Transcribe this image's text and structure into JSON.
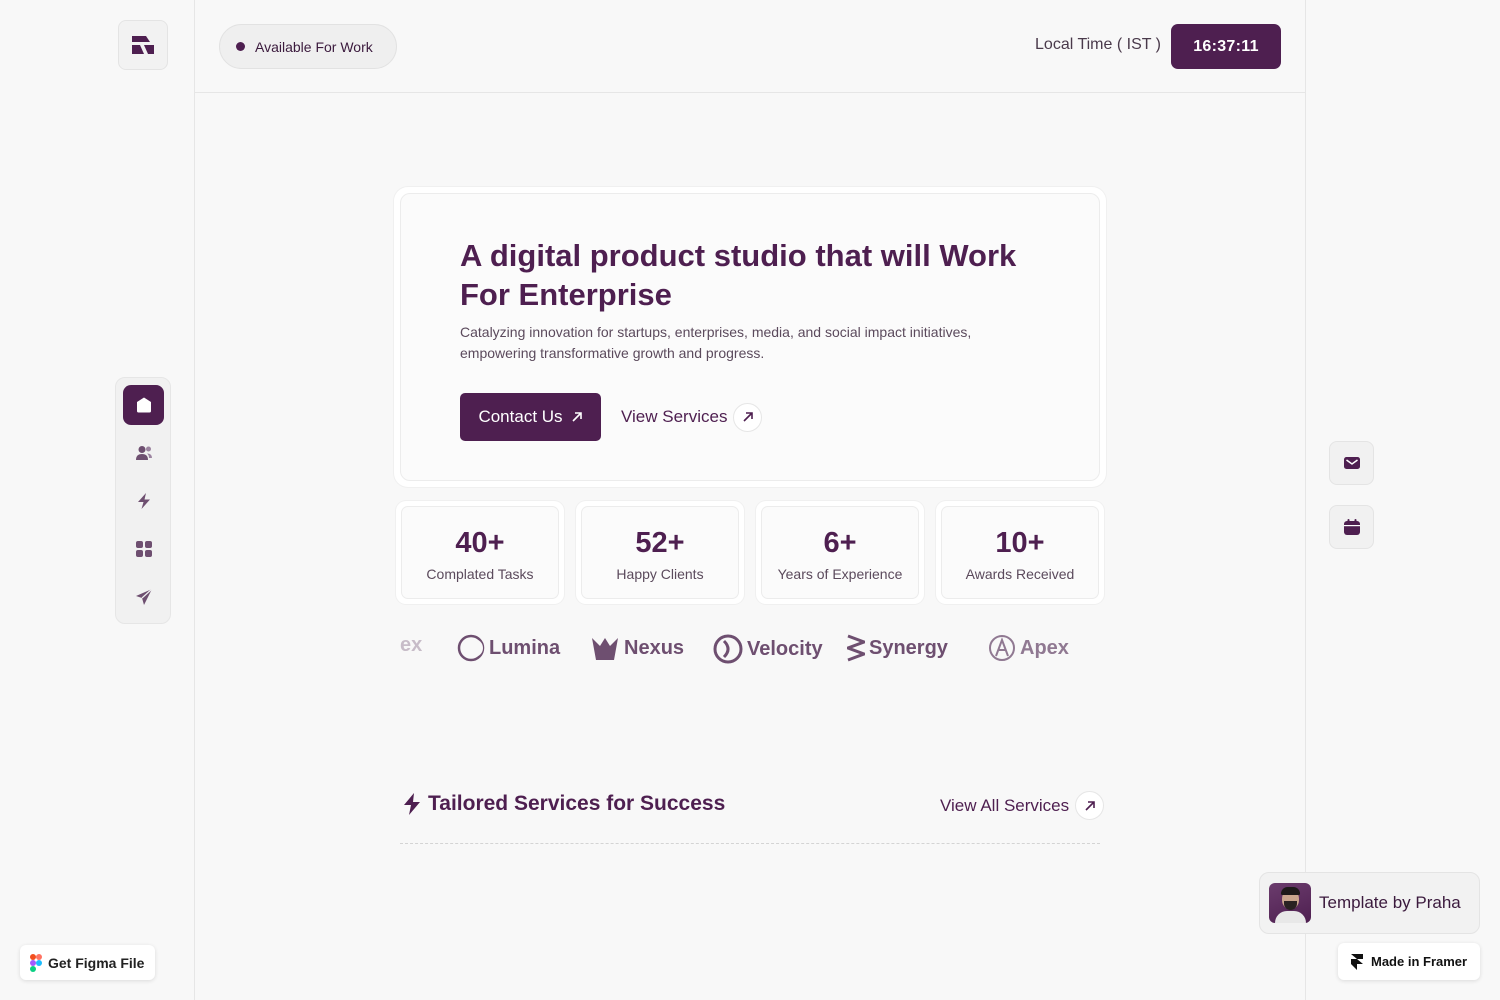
{
  "header": {
    "status_text": "Available For Work",
    "local_time_label": "Local Time ( IST )",
    "time_value": "16:37:11"
  },
  "hero": {
    "title": "A digital product studio that will Work For Enterprise",
    "subtitle": "Catalyzing innovation for startups, enterprises, media, and social impact initiatives, empowering transformative growth and progress.",
    "contact_label": "Contact Us",
    "view_services_label": "View Services"
  },
  "stats": [
    {
      "value": "40+",
      "label": "Complated Tasks"
    },
    {
      "value": "52+",
      "label": "Happy Clients"
    },
    {
      "value": "6+",
      "label": "Years of Experience"
    },
    {
      "value": "10+",
      "label": "Awards Received"
    }
  ],
  "logos": [
    "ex",
    "Lumina",
    "Nexus",
    "Velocity",
    "Synergy",
    "Apex"
  ],
  "services": {
    "title": "Tailored Services for Success",
    "view_all_label": "View All Services"
  },
  "sidebar": {
    "items": [
      "home-icon",
      "users-icon",
      "bolt-icon",
      "grid-icon",
      "send-icon"
    ]
  },
  "right_rail": {
    "buttons": [
      "mail-icon",
      "calendar-icon"
    ]
  },
  "badges": {
    "figma_label": "Get Figma File",
    "template_label": "Template by Praha",
    "framer_label": "Made in Framer"
  },
  "colors": {
    "accent": "#4e1f50",
    "background": "#f8f8f8"
  }
}
